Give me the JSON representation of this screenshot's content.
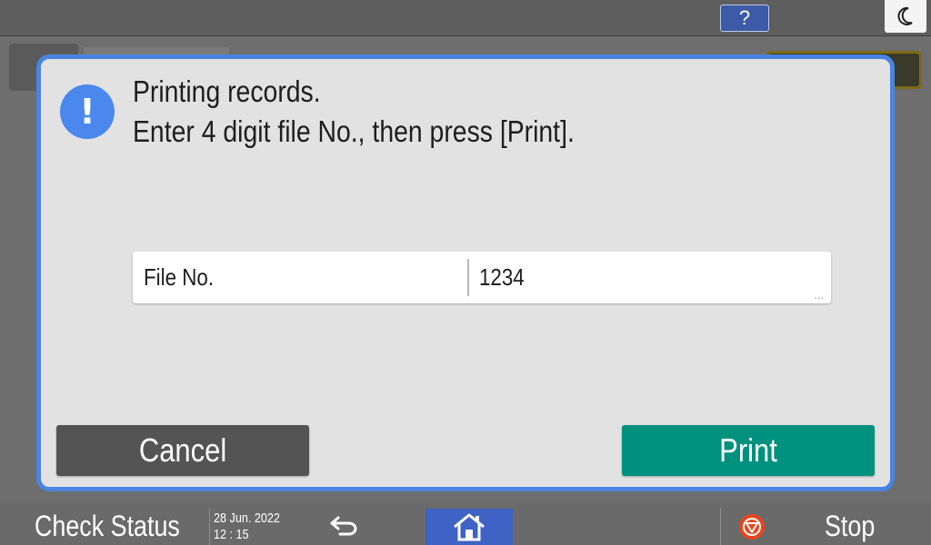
{
  "topbar": {
    "help_label": "?",
    "night_icon": "moon-icon"
  },
  "dialog": {
    "icon": "exclamation-icon",
    "icon_glyph": "!",
    "message_line1": "Printing records.",
    "message_line2": "Enter 4 digit file No., then press [Print].",
    "field": {
      "label": "File No.",
      "value": "1234",
      "more": "..."
    },
    "cancel_label": "Cancel",
    "print_label": "Print"
  },
  "bottombar": {
    "check_status_label": "Check Status",
    "date": "28 Jun. 2022",
    "time": "12 : 15",
    "back_icon": "return-arrow-icon",
    "home_icon": "home-icon",
    "stop_icon": "stop-icon",
    "stop_label": "Stop"
  },
  "colors": {
    "dialog_border": "#4a84e0",
    "print_button": "#00917e",
    "cancel_button": "#545454",
    "home_button": "#3e63c4",
    "stop_icon": "#e8451c"
  }
}
